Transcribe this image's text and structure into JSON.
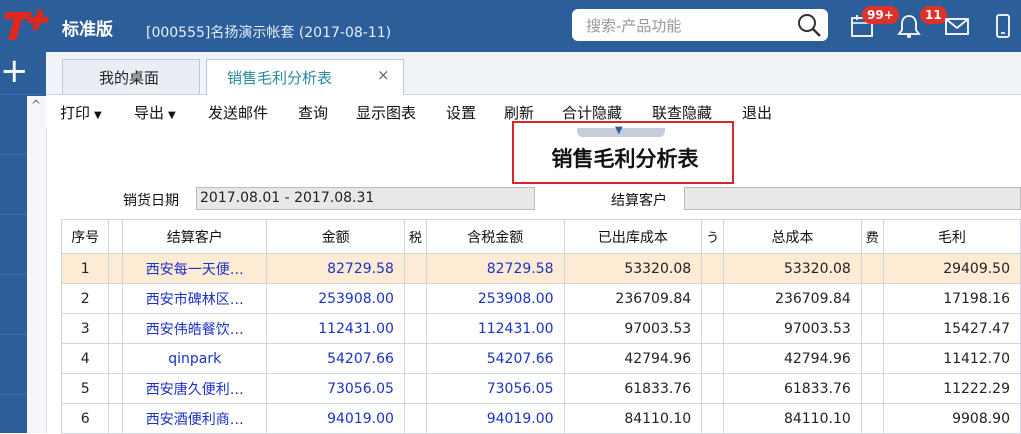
{
  "app": {
    "edition": "标准版",
    "account": "[000555]名扬演示帐套   (2017-08-11)",
    "search_placeholder": "搜索-产品功能",
    "badge_calendar": "99+",
    "badge_bell": "11"
  },
  "tabs": [
    {
      "label": "我的桌面"
    },
    {
      "label": "销售毛利分析表",
      "close": "×"
    }
  ],
  "toolbar": {
    "print": "打印",
    "export": "导出",
    "send_mail": "发送邮件",
    "query": "查询",
    "show_chart": "显示图表",
    "settings": "设置",
    "refresh": "刷新",
    "hide_total": "合计隐藏",
    "hide_linked": "联查隐藏",
    "exit": "退出"
  },
  "report": {
    "title": "销售毛利分析表",
    "date_label": "销货日期",
    "date_value": "2017.08.01 - 2017.08.31",
    "customer_label": "结算客户",
    "customer_value": ""
  },
  "columns": {
    "index": "序号",
    "customer": "结算客户",
    "amount": "金额",
    "clip1": "税",
    "tax_amount": "含税金额",
    "shipped_cost": "已出库成本",
    "clip2": "う",
    "total_cost": "总成本",
    "clip3": "费",
    "gross_profit": "毛利"
  },
  "rows": [
    {
      "no": "1",
      "customer": "西安每一天便…",
      "amount": "82729.58",
      "tax_amount": "82729.58",
      "shipped_cost": "53320.08",
      "total_cost": "53320.08",
      "gross_profit": "29409.50"
    },
    {
      "no": "2",
      "customer": "西安市碑林区…",
      "amount": "253908.00",
      "tax_amount": "253908.00",
      "shipped_cost": "236709.84",
      "total_cost": "236709.84",
      "gross_profit": "17198.16"
    },
    {
      "no": "3",
      "customer": "西安伟皓餐饮…",
      "amount": "112431.00",
      "tax_amount": "112431.00",
      "shipped_cost": "97003.53",
      "total_cost": "97003.53",
      "gross_profit": "15427.47"
    },
    {
      "no": "4",
      "customer": "qinpark",
      "amount": "54207.66",
      "tax_amount": "54207.66",
      "shipped_cost": "42794.96",
      "total_cost": "42794.96",
      "gross_profit": "11412.70"
    },
    {
      "no": "5",
      "customer": "西安唐久便利…",
      "amount": "73056.05",
      "tax_amount": "73056.05",
      "shipped_cost": "61833.76",
      "total_cost": "61833.76",
      "gross_profit": "11222.29"
    },
    {
      "no": "6",
      "customer": "西安酒便利商…",
      "amount": "94019.00",
      "tax_amount": "94019.00",
      "shipped_cost": "84110.10",
      "total_cost": "84110.10",
      "gross_profit": "9908.90"
    }
  ]
}
